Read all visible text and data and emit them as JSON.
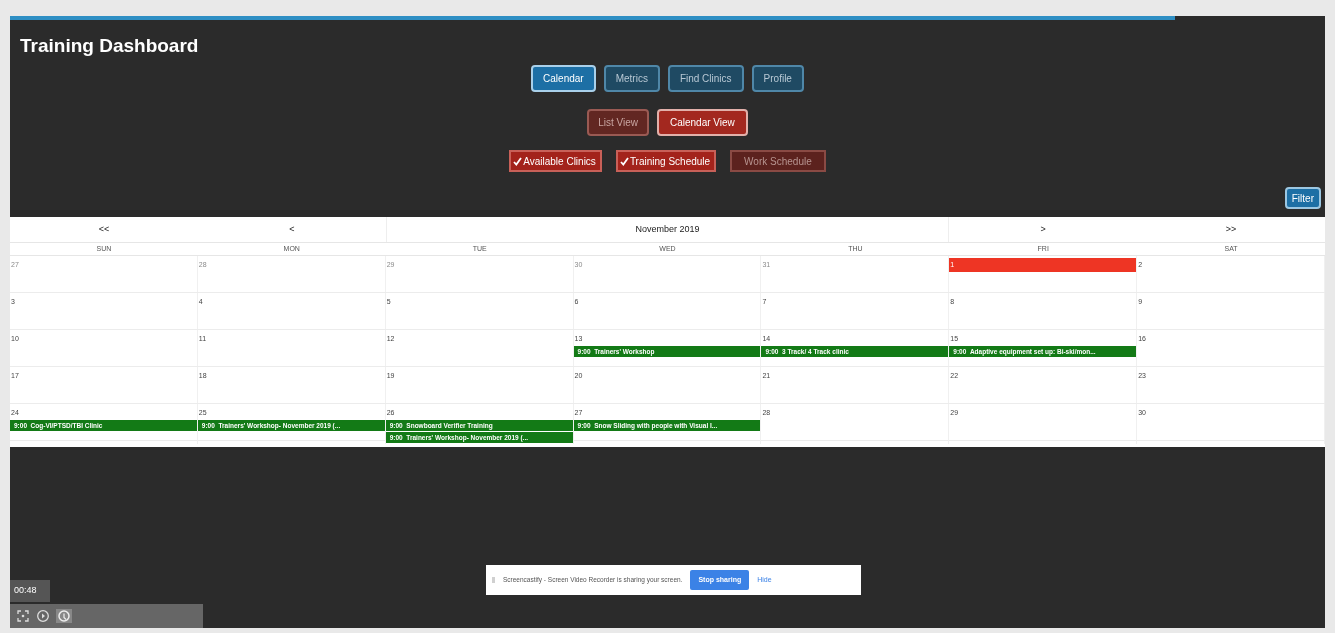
{
  "title": "Training Dashboard",
  "tabs": [
    {
      "label": "Calendar",
      "selected": true
    },
    {
      "label": "Metrics",
      "selected": false
    },
    {
      "label": "Find Clinics",
      "selected": false
    },
    {
      "label": "Profile",
      "selected": false
    }
  ],
  "views": [
    {
      "label": "List View",
      "selected": false
    },
    {
      "label": "Calendar View",
      "selected": true
    }
  ],
  "filters": [
    {
      "label": "Available Clinics",
      "checked": true
    },
    {
      "label": "Training Schedule",
      "checked": true
    },
    {
      "label": "Work Schedule",
      "checked": false
    }
  ],
  "filter_button": "Filter",
  "calendar": {
    "nav": [
      "<<",
      "<",
      "November 2019",
      ">",
      ">>"
    ],
    "weekdays": [
      "SUN",
      "MON",
      "TUE",
      "WED",
      "THU",
      "FRI",
      "SAT"
    ],
    "weeks": [
      [
        {
          "day": "27",
          "other_month": true
        },
        {
          "day": "28",
          "other_month": true
        },
        {
          "day": "29",
          "other_month": true
        },
        {
          "day": "30",
          "other_month": true
        },
        {
          "day": "31",
          "other_month": true
        },
        {
          "day": "1",
          "today": true
        },
        {
          "day": "2"
        }
      ],
      [
        {
          "day": "3"
        },
        {
          "day": "4"
        },
        {
          "day": "5"
        },
        {
          "day": "6"
        },
        {
          "day": "7"
        },
        {
          "day": "8"
        },
        {
          "day": "9"
        }
      ],
      [
        {
          "day": "10"
        },
        {
          "day": "11"
        },
        {
          "day": "12"
        },
        {
          "day": "13",
          "events": [
            {
              "time": "9:00",
              "title": "Trainers' Workshop"
            }
          ]
        },
        {
          "day": "14",
          "events": [
            {
              "time": "9:00",
              "title": "3 Track/ 4 Track clinic"
            }
          ]
        },
        {
          "day": "15",
          "events": [
            {
              "time": "9:00",
              "title": "Adaptive equipment set up: Bi-ski/mon..."
            }
          ]
        },
        {
          "day": "16"
        }
      ],
      [
        {
          "day": "17"
        },
        {
          "day": "18"
        },
        {
          "day": "19"
        },
        {
          "day": "20"
        },
        {
          "day": "21"
        },
        {
          "day": "22"
        },
        {
          "day": "23"
        }
      ],
      [
        {
          "day": "24",
          "events": [
            {
              "time": "9:00",
              "title": "Cog-VI/PTSD/TBI Clinic"
            }
          ]
        },
        {
          "day": "25",
          "events": [
            {
              "time": "9:00",
              "title": "Trainers' Workshop- November 2019 (..."
            }
          ]
        },
        {
          "day": "26",
          "events": [
            {
              "time": "9:00",
              "title": "Snowboard Verifier Training"
            },
            {
              "time": "9:00",
              "title": "Trainers' Workshop- November 2019 (..."
            }
          ]
        },
        {
          "day": "27",
          "events": [
            {
              "time": "9:00",
              "title": "Snow Sliding with people with Visual I..."
            }
          ]
        },
        {
          "day": "28"
        },
        {
          "day": "29"
        },
        {
          "day": "30"
        }
      ]
    ]
  },
  "sharing_bar": {
    "message": "Screencastify - Screen Video Recorder is sharing your screen.",
    "stop_button": "Stop sharing",
    "hide_link": "Hide"
  },
  "player": {
    "time": "00:48"
  }
}
